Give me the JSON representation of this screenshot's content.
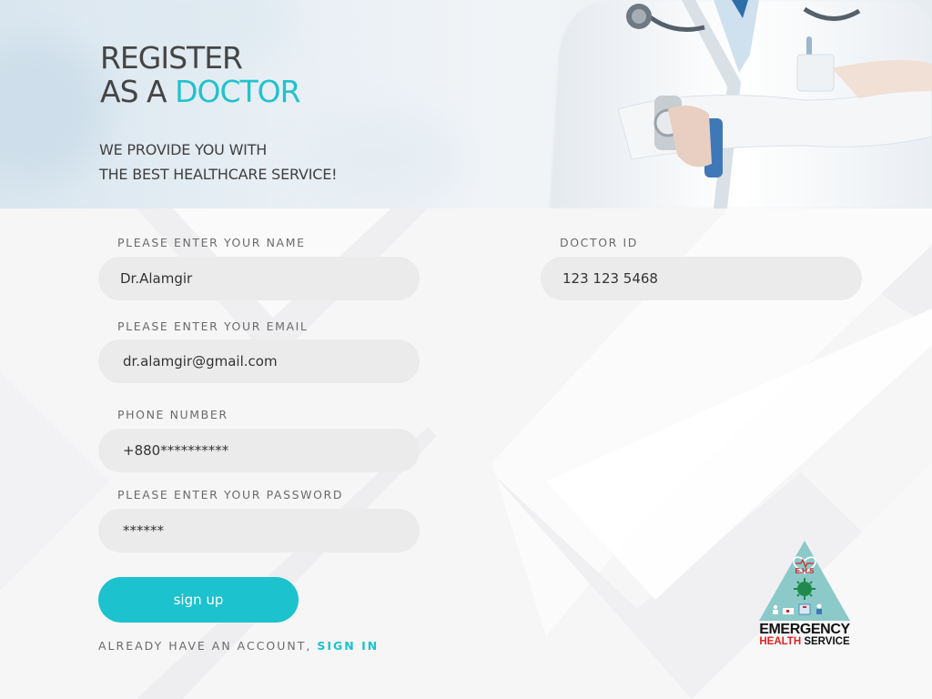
{
  "hero": {
    "title_line1": "REGISTER",
    "title_line2_prefix": "AS A ",
    "title_line2_accent": "DOCTOR",
    "subtitle_line1": "WE PROVIDE YOU WITH",
    "subtitle_line2": "THE BEST HEALTHCARE SERVICE!"
  },
  "form": {
    "name_label": "PLEASE ENTER YOUR NAME",
    "name_value": "Dr.Alamgir",
    "email_label": "PLEASE ENTER YOUR EMAIL",
    "email_value": "dr.alamgir@gmail.com",
    "phone_label": "PHONE NUMBER",
    "phone_value": "+880**********",
    "password_label": "PLEASE ENTER YOUR PASSWORD",
    "password_value": "******",
    "doctor_id_label": "DOCTOR ID",
    "doctor_id_value": "123 123 5468",
    "signup_label": "sign up",
    "account_prompt": "ALREADY HAVE AN ACCOUNT, ",
    "signin_label": "SIGN IN"
  },
  "logo": {
    "badge": "E.H.S",
    "line1": "EMERGENCY",
    "line2_red": "HEALTH",
    "line2_rest": " SERVICE"
  },
  "colors": {
    "accent": "#1cc2cd",
    "field_bg": "#ebebeb",
    "title_text": "#454545",
    "logo_triangle": "#8cc9c9",
    "logo_red": "#e02121"
  },
  "icons": [
    "doctor-photo",
    "ehs-triangle-logo",
    "virus-icon",
    "heart-pulse-icon",
    "ambulance-icon",
    "hospital-icon"
  ]
}
